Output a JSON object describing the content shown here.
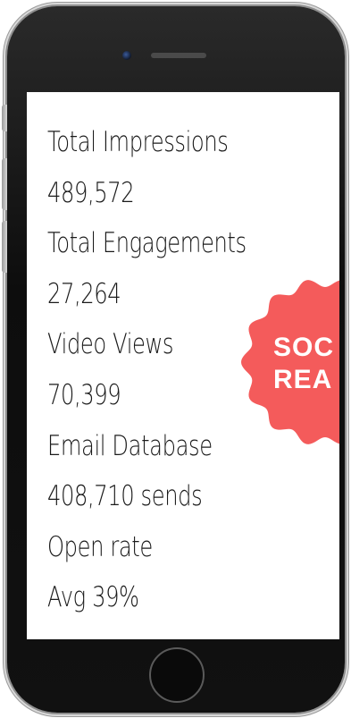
{
  "stats": {
    "items": [
      "Total Impressions",
      "489,572",
      "Total Engagements",
      "27,264",
      "Video Views",
      "70,399",
      "Email Database",
      "408,710 sends",
      "Open rate",
      "Avg 39%"
    ]
  },
  "badge": {
    "line1": "SOC",
    "line2": "REA",
    "color": "#f45b5b"
  }
}
